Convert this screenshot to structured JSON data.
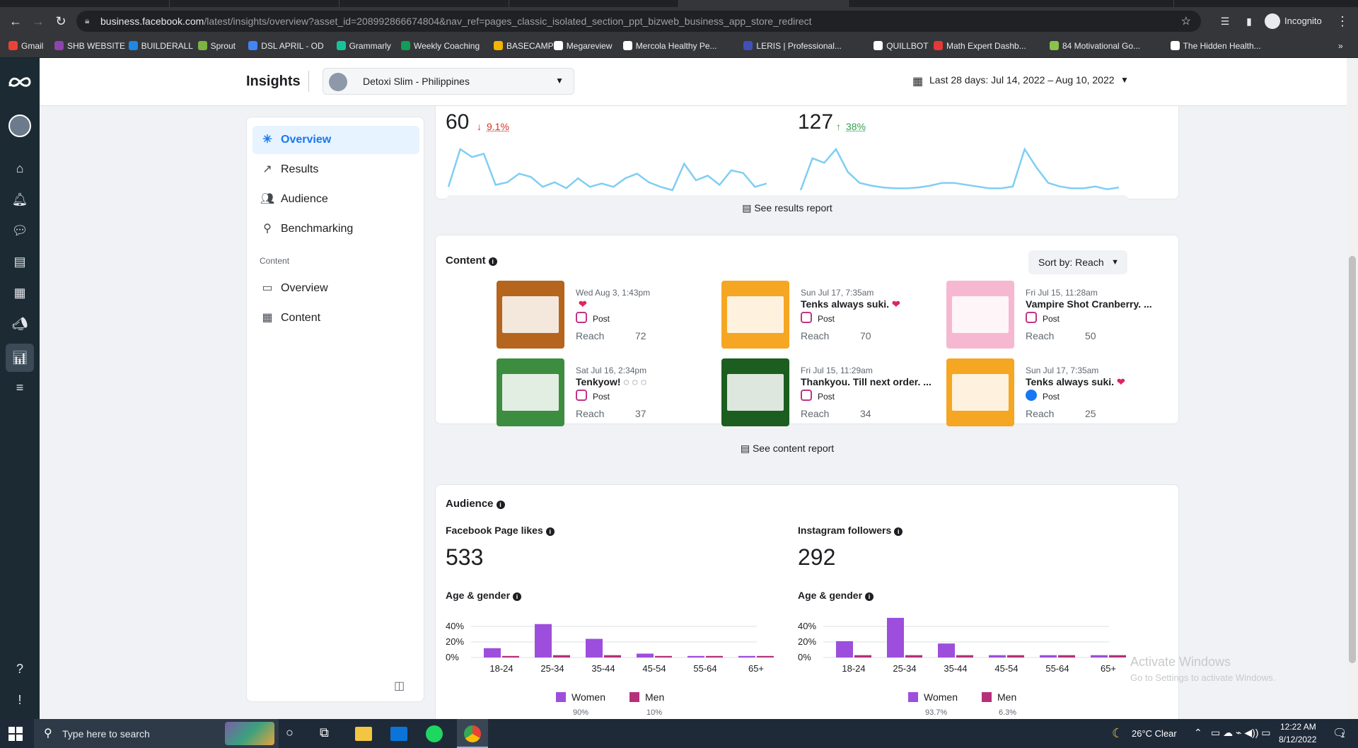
{
  "browser": {
    "url_domain": "business.facebook.com",
    "url_path": "/latest/insights/overview?asset_id=208992866674804&nav_ref=pages_classic_isolated_section_ppt_bizweb_business_app_store_redirect",
    "profile_label": "Incognito",
    "bookmarks": [
      "Gmail",
      "SHB WEBSITE",
      "BUILDERALL",
      "Sprout",
      "DSL APRIL - OD",
      "Grammarly",
      "Weekly Coaching",
      "BASECAMP",
      "Megareview",
      "Mercola Healthy Pe...",
      "LERIS | Professional...",
      "QUILLBOT",
      "Math Expert Dashb...",
      "84 Motivational Go...",
      "The Hidden Health..."
    ],
    "bookmark_colors": [
      "#ea4335",
      "#8e44ad",
      "#1e88e5",
      "#7cb342",
      "#4285f4",
      "#15c39a",
      "#0f9d58",
      "#f4b400",
      "#ffffff",
      "#ffffff",
      "#3f51b5",
      "#ffffff",
      "#e53935",
      "#8bc34a",
      "#ffffff"
    ]
  },
  "header": {
    "title": "Insights",
    "account_name": "Detoxi Slim - Philippines",
    "date_range": "Last 28 days: Jul 14, 2022 – Aug 10, 2022"
  },
  "sidebar": {
    "items": [
      {
        "label": "Overview",
        "icon": "overview-icon",
        "active": true
      },
      {
        "label": "Results",
        "icon": "results-icon"
      },
      {
        "label": "Audience",
        "icon": "audience-icon"
      },
      {
        "label": "Benchmarking",
        "icon": "benchmarking-icon"
      }
    ],
    "section_label": "Content",
    "content_items": [
      {
        "label": "Overview",
        "icon": "content-overview-icon"
      },
      {
        "label": "Content",
        "icon": "content-table-icon"
      }
    ]
  },
  "results": {
    "left_value": "60",
    "left_change": "9.1%",
    "left_change_direction": "down",
    "right_value": "127",
    "right_change": "38%",
    "right_change_direction": "up",
    "left_sparkline": [
      5,
      62,
      50,
      55,
      8,
      12,
      25,
      20,
      5,
      12,
      3,
      18,
      5,
      10,
      5,
      18,
      25,
      12,
      5,
      0,
      40,
      15,
      22,
      8,
      30,
      26,
      5,
      10
    ],
    "right_sparkline": [
      0,
      35,
      30,
      45,
      20,
      8,
      5,
      3,
      2,
      2,
      3,
      5,
      8,
      8,
      6,
      4,
      2,
      2,
      4,
      45,
      25,
      8,
      4,
      2,
      2,
      4,
      1,
      3
    ],
    "see_report_label": "See results report",
    "sparkline_color": "#7fcef4"
  },
  "content": {
    "title": "Content",
    "sort_label": "Sort by: Reach",
    "posts": [
      {
        "date": "Wed Aug 3, 1:43pm",
        "title": "",
        "emoji": "❤",
        "platform": "instagram",
        "type": "Post",
        "reach_label": "Reach",
        "reach": "72",
        "thumb_color": "#b5651d"
      },
      {
        "date": "Sun Jul 17, 7:35am",
        "title": "Tenks always suki.",
        "emoji": "❤",
        "platform": "instagram",
        "type": "Post",
        "reach_label": "Reach",
        "reach": "70",
        "thumb_color": "#f5a623"
      },
      {
        "date": "Fri Jul 15, 11:28am",
        "title": "Vampire Shot Cranberry. ...",
        "emoji": "",
        "platform": "instagram",
        "type": "Post",
        "reach_label": "Reach",
        "reach": "50",
        "thumb_color": "#f6b8d1"
      },
      {
        "date": "Sat Jul 16, 2:34pm",
        "title": "Tenkyow! ◌ ◌ ◌",
        "emoji": "",
        "platform": "instagram",
        "type": "Post",
        "reach_label": "Reach",
        "reach": "37",
        "thumb_color": "#3c8d40"
      },
      {
        "date": "Fri Jul 15, 11:29am",
        "title": "Thankyou. Till next order. ...",
        "emoji": "",
        "platform": "instagram",
        "type": "Post",
        "reach_label": "Reach",
        "reach": "34",
        "thumb_color": "#1b5e20"
      },
      {
        "date": "Sun Jul 17, 7:35am",
        "title": "Tenks always suki.",
        "emoji": "❤",
        "platform": "facebook",
        "type": "Post",
        "reach_label": "Reach",
        "reach": "25",
        "thumb_color": "#f5a623"
      }
    ],
    "see_report_label": "See content report"
  },
  "audience": {
    "title": "Audience",
    "fb_label": "Facebook Page likes",
    "fb_value": "533",
    "ig_label": "Instagram followers",
    "ig_value": "292",
    "age_gender_label": "Age & gender",
    "women_label": "Women",
    "men_label": "Men",
    "women_color": "#9d4edd",
    "men_color": "#b5307a"
  },
  "chart_data": [
    {
      "type": "bar",
      "title": "Age & gender",
      "categories": [
        "18-24",
        "25-34",
        "35-44",
        "45-54",
        "55-64",
        "65+"
      ],
      "series": [
        {
          "name": "Women",
          "values": [
            12,
            43,
            24,
            5,
            2,
            2
          ]
        },
        {
          "name": "Men",
          "values": [
            2,
            3,
            3,
            2,
            2,
            2
          ]
        }
      ],
      "yticks": [
        "40%",
        "20%",
        "0%"
      ],
      "ylim": [
        0,
        40
      ],
      "legend_pcts": [
        "90%",
        "10%"
      ]
    },
    {
      "type": "bar",
      "title": "Age & gender",
      "categories": [
        "18-24",
        "25-34",
        "35-44",
        "45-54",
        "55-64",
        "65+"
      ],
      "series": [
        {
          "name": "Women",
          "values": [
            21,
            51,
            18,
            3,
            3,
            3
          ]
        },
        {
          "name": "Men",
          "values": [
            3,
            3,
            3,
            3,
            3,
            3
          ]
        }
      ],
      "yticks": [
        "40%",
        "20%",
        "0%"
      ],
      "ylim": [
        0,
        40
      ],
      "legend_pcts": [
        "93.7%",
        "6.3%"
      ]
    }
  ],
  "windows": {
    "activate_title": "Activate Windows",
    "activate_sub": "Go to Settings to activate Windows.",
    "search_placeholder": "Type here to search",
    "weather": "26°C  Clear",
    "time": "12:22 AM",
    "date": "8/12/2022",
    "notification_count": "1"
  }
}
